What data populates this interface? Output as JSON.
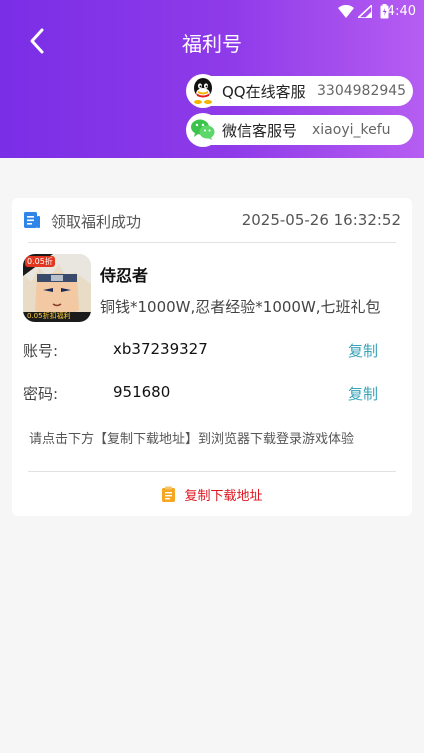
{
  "status_bar": {
    "time": "4:40"
  },
  "header": {
    "title": "福利号"
  },
  "contacts": {
    "qq": {
      "label": "QQ在线客服",
      "value": "3304982945"
    },
    "wechat": {
      "label": "微信客服号",
      "value": "xiaoyi_kefu"
    }
  },
  "card": {
    "status": "领取福利成功",
    "datetime": "2025-05-26 16:32:52",
    "game": {
      "name": "侍忍者",
      "rewards": "铜钱*1000W,忍者经验*1000W,七班礼包",
      "badge_top": "0.05折",
      "badge_bottom": "0.05折扣福利"
    },
    "account": {
      "label": "账号:",
      "value": "xb37239327",
      "copy": "复制"
    },
    "password": {
      "label": "密码:",
      "value": "951680",
      "copy": "复制"
    },
    "hint": "请点击下方【复制下载地址】到浏览器下载登录游戏体验",
    "download_button": "复制下载地址"
  }
}
